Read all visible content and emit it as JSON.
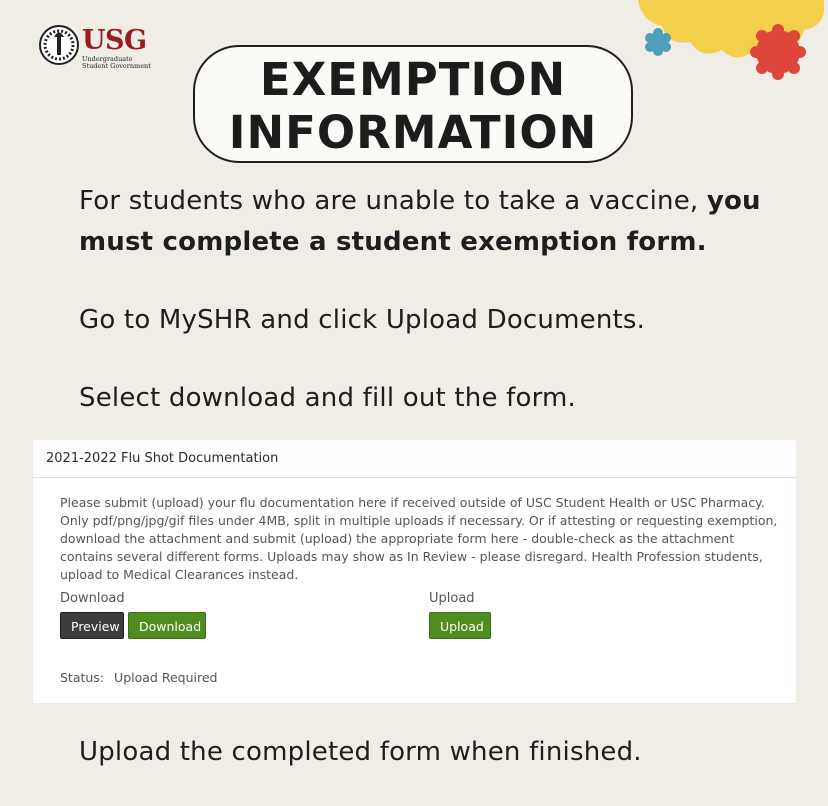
{
  "logo": {
    "mark": "USG",
    "subtitle_line1": "Undergraduate",
    "subtitle_line2": "Student Government"
  },
  "title": {
    "line1": "EXEMPTION",
    "line2": "INFORMATION"
  },
  "paragraphs": {
    "p1_normal": "For students who are unable to take a vaccine, ",
    "p1_bold": "you must complete a student exemption form.",
    "p2": "Go to MySHR and click Upload Documents.",
    "p3": "Select download and fill out the form.",
    "p4": "Upload the completed form when finished."
  },
  "card": {
    "header": "2021-2022 Flu Shot Documentation",
    "description": "Please submit (upload) your flu documentation here if received outside of USC Student Health or USC Pharmacy. Only pdf/png/jpg/gif files under 4MB, split in multiple uploads if necessary. Or if attesting or requesting exemption, download the attachment and submit (upload) the appropriate form here - double-check as the attachment contains several different forms. Uploads may show as In Review - please disregard. Health Profession students, upload to Medical Clearances instead.",
    "download_label": "Download",
    "upload_label": "Upload",
    "preview_button": "Preview",
    "download_button": "Download",
    "upload_button": "Upload",
    "status_label": "Status:",
    "status_value": "Upload Required"
  },
  "colors": {
    "background": "#efede6",
    "brand_red": "#9b1b1e",
    "button_green": "#4e8d1e",
    "button_dark": "#3d3d3d",
    "deco_yellow": "#f3cf4a",
    "deco_blue": "#4f9fb8",
    "deco_red": "#e0473c"
  },
  "icons": {
    "logo_emblem": "torch-seal-icon"
  }
}
